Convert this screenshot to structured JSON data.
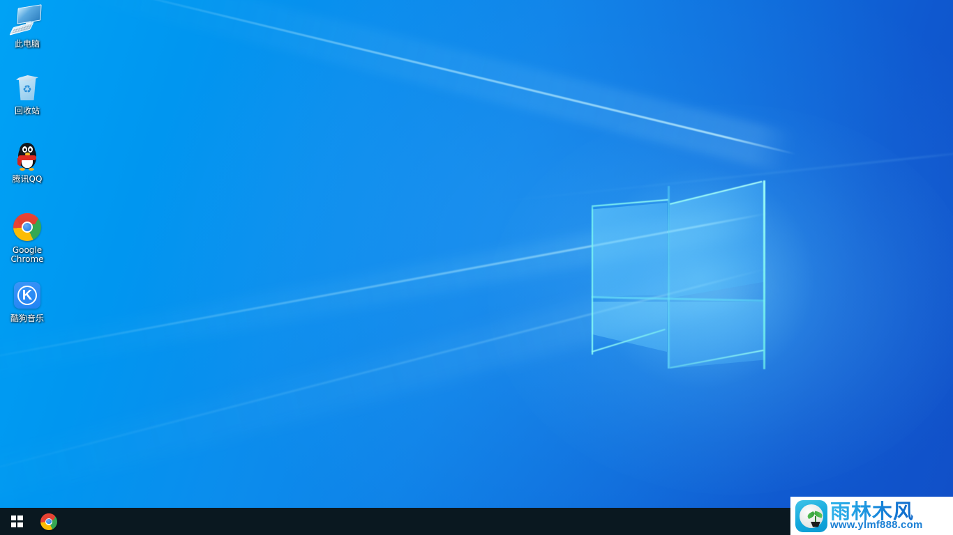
{
  "desktop": {
    "wallpaper_name": "windows-10-hero-blue",
    "colors": {
      "wallpaper_left": "#00a2f5",
      "wallpaper_right": "#1150c8",
      "logo_glow": "#78f2e8",
      "taskbar": "#0a1820"
    },
    "icons": [
      {
        "label": "此电脑",
        "icon": "this-pc-icon"
      },
      {
        "label": "回收站",
        "icon": "recycle-bin-icon",
        "glyph": "♻"
      },
      {
        "label": "腾讯QQ",
        "icon": "tencent-qq-icon"
      },
      {
        "label": "Google\nChrome",
        "label_line1": "Google",
        "label_line2": "Chrome",
        "icon": "google-chrome-icon"
      },
      {
        "label": "酷狗音乐",
        "icon": "kugou-music-icon",
        "glyph": "K"
      }
    ]
  },
  "taskbar": {
    "start_button": {
      "name": "start-button",
      "icon": "windows-logo-icon",
      "tooltip": "开始"
    },
    "pinned": [
      {
        "name": "taskbar-chrome",
        "icon": "google-chrome-icon",
        "tooltip": "Google Chrome"
      }
    ],
    "tray": {
      "items": []
    }
  },
  "watermark": {
    "logo_icon": "ylmf-sprout-logo-icon",
    "brand": "雨林木风",
    "url": "www.ylmf888.com",
    "brand_color": "#1f9ce2",
    "url_color": "#1a7fd4",
    "background": "#ffffff"
  }
}
